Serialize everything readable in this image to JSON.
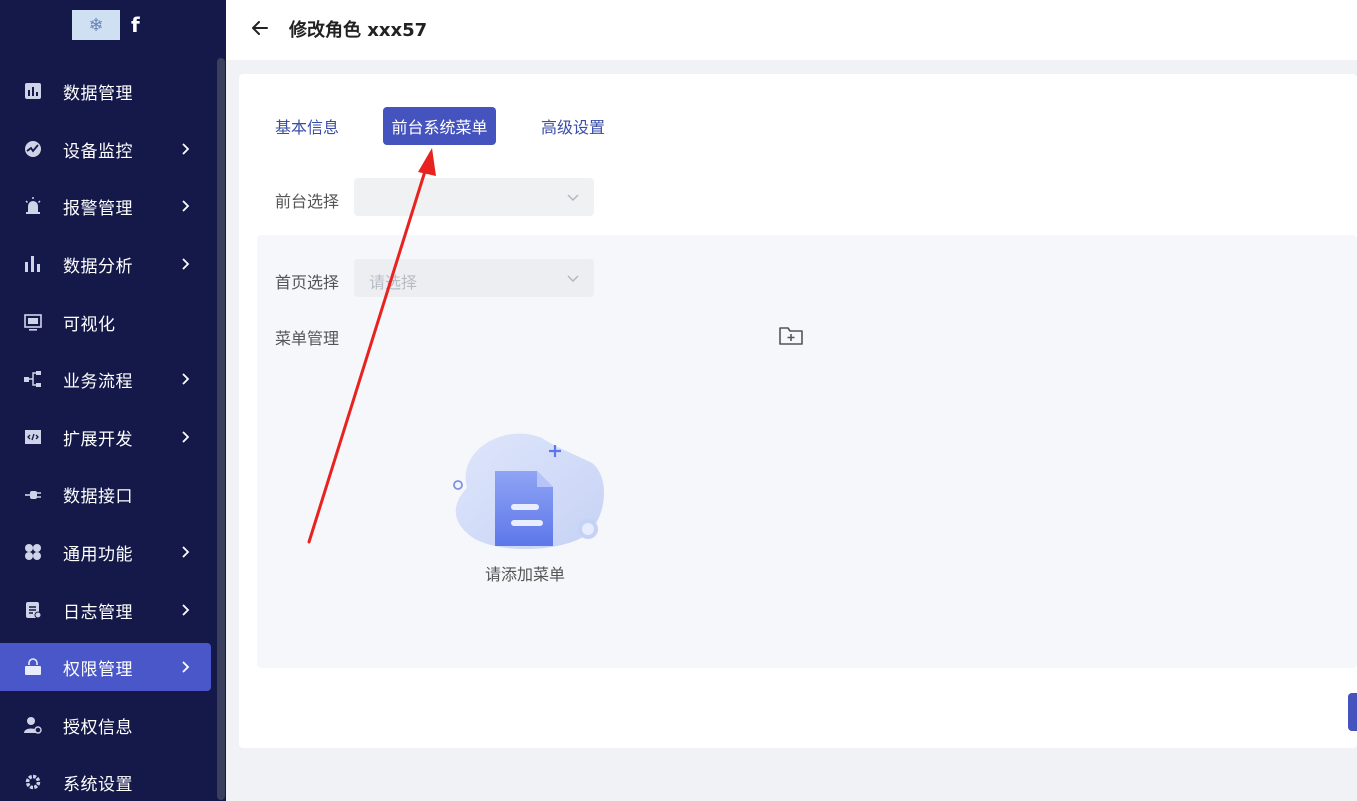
{
  "app": {
    "brand_letter": "f",
    "logo_icon": "snowflake-logo-icon"
  },
  "sidebar": {
    "items": [
      {
        "label": "数据管理",
        "icon": "bar-chart-icon",
        "has_children": false,
        "active": false
      },
      {
        "label": "设备监控",
        "icon": "monitor-gauge-icon",
        "has_children": true,
        "active": false
      },
      {
        "label": "报警管理",
        "icon": "alarm-light-icon",
        "has_children": true,
        "active": false
      },
      {
        "label": "数据分析",
        "icon": "column-chart-icon",
        "has_children": true,
        "active": false
      },
      {
        "label": "可视化",
        "icon": "screen-icon",
        "has_children": false,
        "active": false
      },
      {
        "label": "业务流程",
        "icon": "flow-tree-icon",
        "has_children": true,
        "active": false
      },
      {
        "label": "扩展开发",
        "icon": "code-window-icon",
        "has_children": true,
        "active": false
      },
      {
        "label": "数据接口",
        "icon": "plug-icon",
        "has_children": false,
        "active": false
      },
      {
        "label": "通用功能",
        "icon": "four-petal-icon",
        "has_children": true,
        "active": false
      },
      {
        "label": "日志管理",
        "icon": "log-file-icon",
        "has_children": true,
        "active": false
      },
      {
        "label": "权限管理",
        "icon": "permission-lock-icon",
        "has_children": true,
        "active": true
      },
      {
        "label": "授权信息",
        "icon": "user-badge-icon",
        "has_children": false,
        "active": false
      },
      {
        "label": "系统设置",
        "icon": "gear-icon",
        "has_children": false,
        "active": false
      }
    ]
  },
  "header": {
    "title": "修改角色 xxx57",
    "back_icon": "arrow-left-icon"
  },
  "tabs": [
    {
      "label": "基本信息",
      "active": false
    },
    {
      "label": "前台系统菜单",
      "active": true
    },
    {
      "label": "高级设置",
      "active": false
    }
  ],
  "form": {
    "frontend_label": "前台选择",
    "frontend_value": "",
    "homepage_label": "首页选择",
    "homepage_placeholder": "请选择",
    "menu_label": "菜单管理",
    "add_folder_icon": "folder-add-icon"
  },
  "empty_state": {
    "text": "请添加菜单",
    "icon": "empty-document-icon"
  },
  "colors": {
    "sidebar_bg": "#14194a",
    "sidebar_active": "#4a57c8",
    "accent": "#4453bd",
    "annotation_arrow": "#e8231f"
  }
}
